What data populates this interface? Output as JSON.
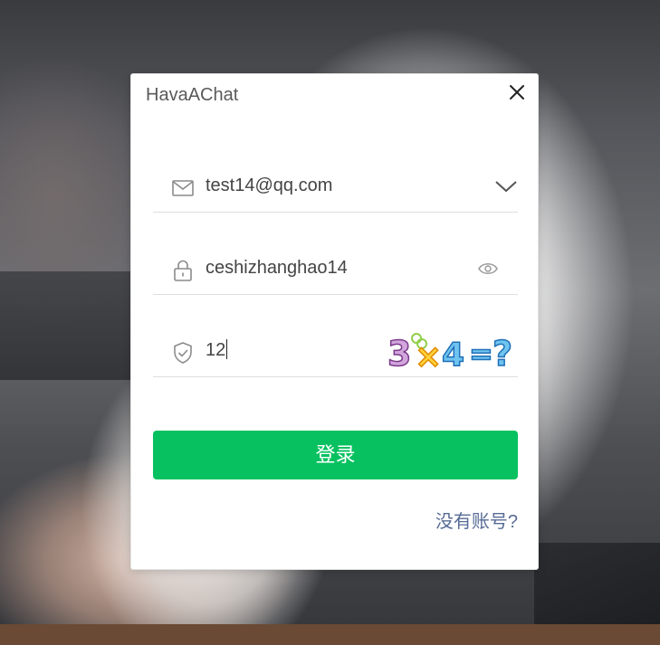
{
  "dialog": {
    "title": "HavaAChat",
    "close_icon": "close-icon"
  },
  "form": {
    "email": {
      "icon": "mail-icon",
      "value": "test14@qq.com",
      "dropdown_icon": "chevron-down-icon"
    },
    "password": {
      "icon": "lock-icon",
      "value": "ceshizhanghao14",
      "toggle_icon": "eye-icon"
    },
    "captcha": {
      "icon": "shield-check-icon",
      "value": "12",
      "image_text": "3×4=?"
    },
    "login_label": "登录",
    "register_label": "没有账号?"
  },
  "colors": {
    "accent": "#07c160",
    "link": "#576b95"
  }
}
